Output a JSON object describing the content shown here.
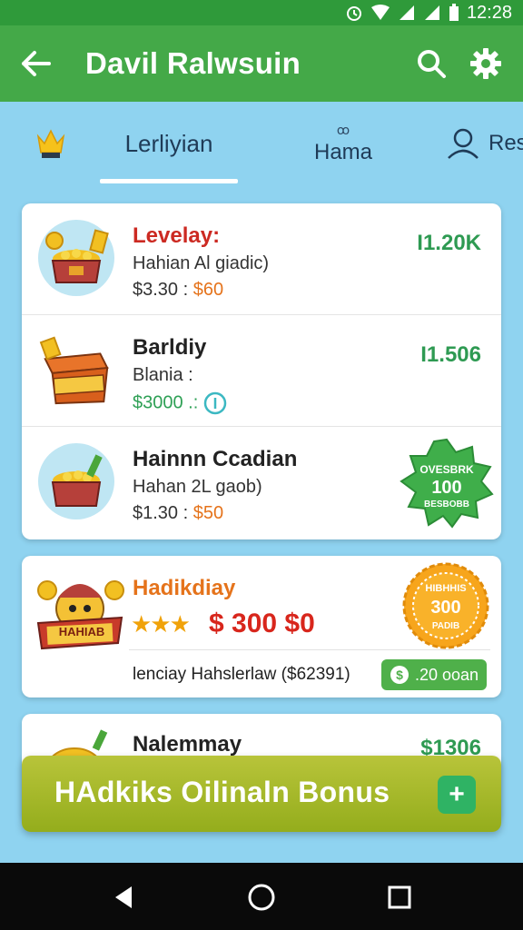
{
  "status_bar": {
    "time": "12:28"
  },
  "app_bar": {
    "title": "Davil Ralwsuin"
  },
  "tabs": [
    {
      "label": "Lerliyian",
      "active": true
    },
    {
      "label": "Hama",
      "caption": "ꝏ"
    },
    {
      "label": "Res"
    }
  ],
  "list": [
    {
      "name": "Levelay:",
      "subtitle": "Hahian Al giadic)",
      "price": "$3.30 : ",
      "price_accent": "$60",
      "amount": "I1.20K"
    },
    {
      "name": "Barldiy",
      "subtitle": "Blania :",
      "price": "$3000 .:",
      "amount": "I1.506"
    },
    {
      "name": "Hainnn Ccadian",
      "subtitle": "Hahan 2L gaob)",
      "price": "$1.30 : ",
      "price_accent": "$50",
      "badge_top": "OVESBRK",
      "badge_value": "100",
      "badge_bottom": "BESBOBB"
    }
  ],
  "promo": {
    "name": "Hadikdiay",
    "stars": "★★★",
    "big_price": "$ 300 $0",
    "footer": "lenciay Hahslerlaw ($62391)",
    "button": ".20 ooan",
    "badge_top": "HIBHHIS",
    "badge_value": "300",
    "badge_bottom": "PADIB",
    "box_label": "HAHIAB"
  },
  "partial_item": {
    "name": "Nalemmay",
    "amount": "$1306"
  },
  "bonus_banner": {
    "label": "HAdkiks Oilinaln Bonus",
    "button": "+"
  },
  "colors": {
    "primary": "#44a948",
    "status": "#2f9a3a",
    "background": "#8fd3f0",
    "accent_orange": "#e5731b",
    "accent_green": "#2e9a52"
  }
}
